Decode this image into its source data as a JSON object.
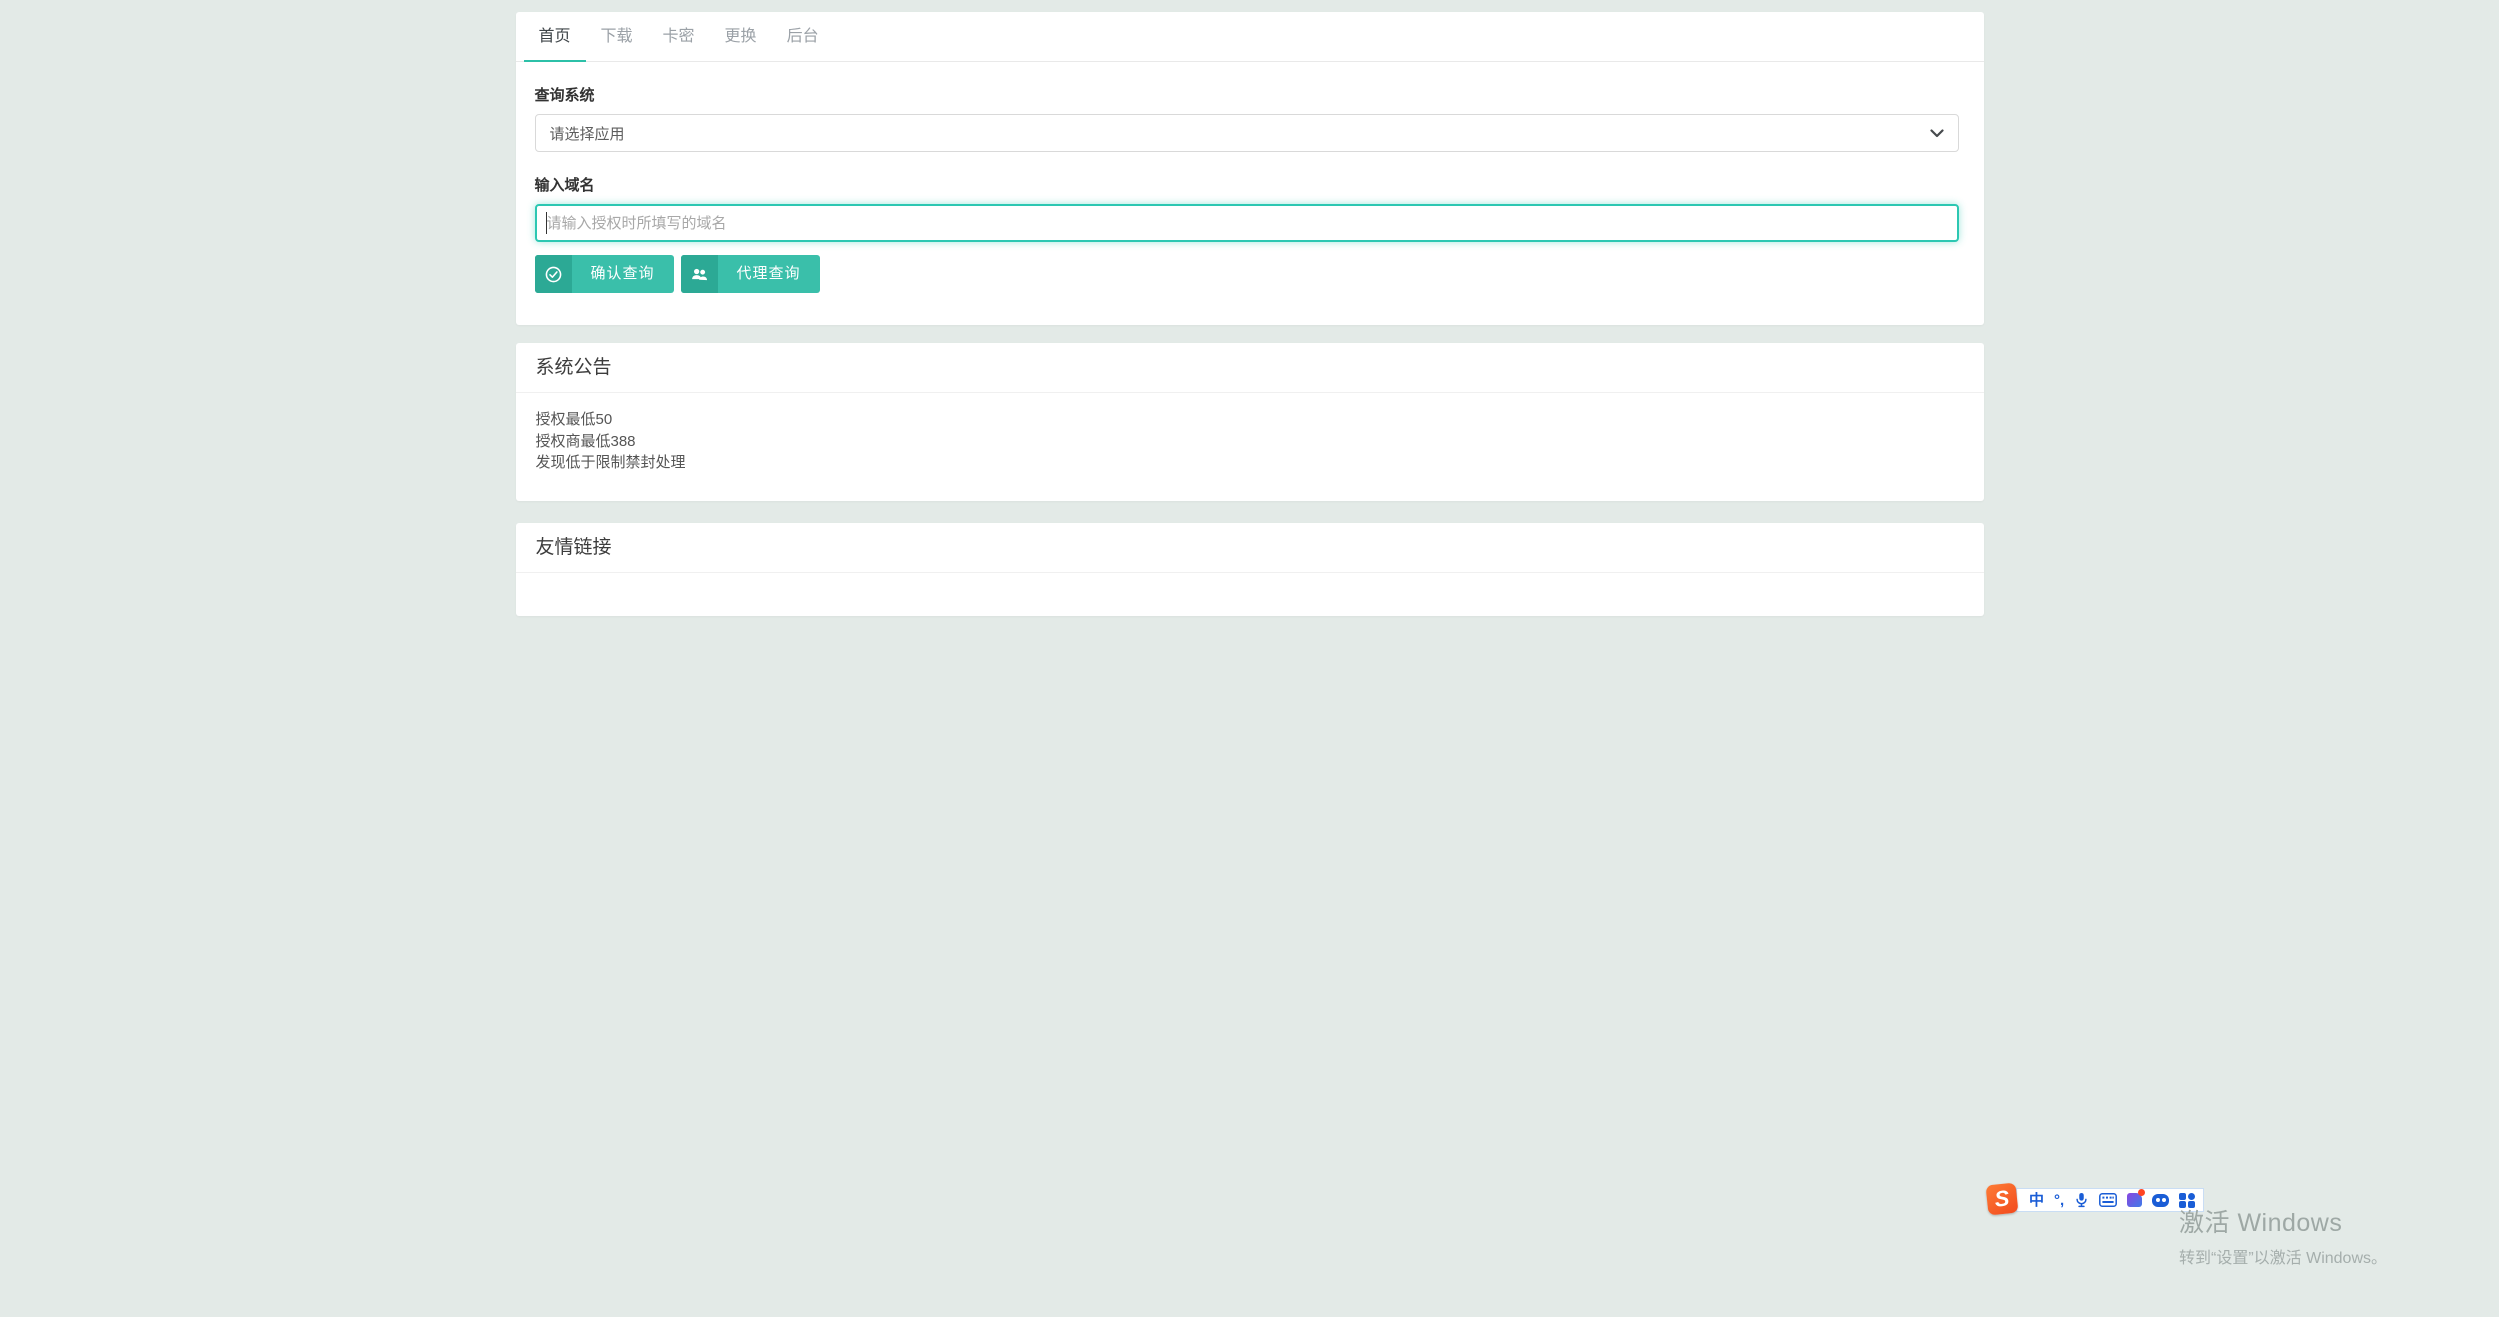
{
  "colors": {
    "page_background": "#e3eae7",
    "accent_teal": "#2cc0a8",
    "button_body_teal": "#3abfaa",
    "button_icon_teal": "#2ca995",
    "input_focus_border": "#2cc7b2",
    "ime_blue": "#1a5dd6",
    "sogou_orange": "#f75728"
  },
  "tabs": {
    "items": [
      {
        "label": "首页",
        "active": true
      },
      {
        "label": "下载",
        "active": false
      },
      {
        "label": "卡密",
        "active": false
      },
      {
        "label": "更换",
        "active": false
      },
      {
        "label": "后台",
        "active": false
      }
    ]
  },
  "query_form": {
    "system_label": "查询系统",
    "system_select_value": "请选择应用",
    "domain_label": "输入域名",
    "domain_placeholder": "请输入授权时所填写的域名",
    "domain_value": "",
    "confirm_button": "确认查询",
    "agent_button": "代理查询"
  },
  "announcement": {
    "title": "系统公告",
    "lines": [
      "授权最低50",
      "授权商最低388",
      "发现低于限制禁封处理"
    ]
  },
  "friend_links": {
    "title": "友情链接"
  },
  "ime": {
    "logo_letter": "S",
    "mode_label": "中",
    "punctuation_label": "°,"
  },
  "watermark": {
    "line1": "激活 Windows",
    "line2": "转到“设置”以激活 Windows。"
  }
}
